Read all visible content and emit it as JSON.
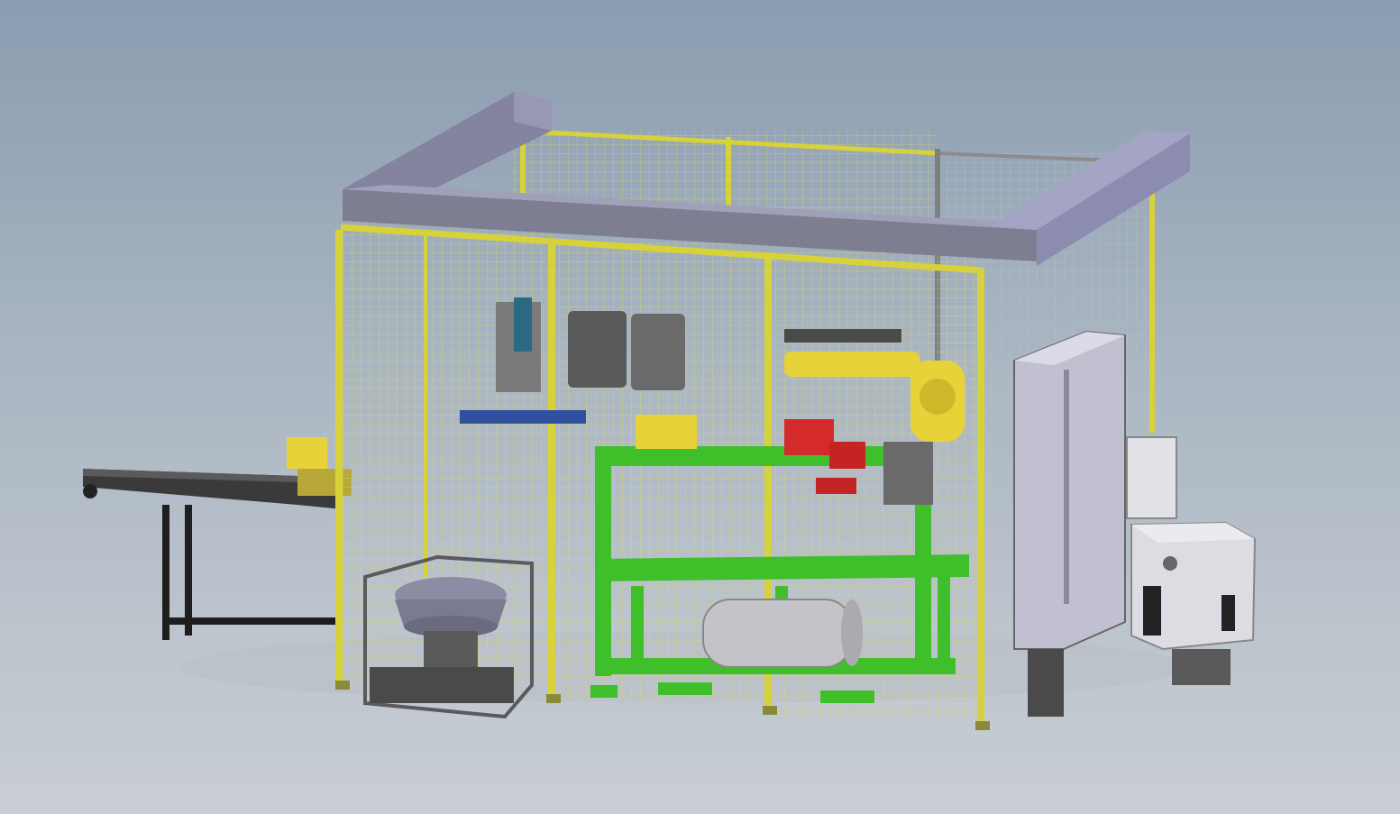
{
  "viewport": {
    "background_top": "#8a9cb0",
    "background_bottom": "#c9ced4"
  },
  "colors": {
    "fence_frame": "#d8d23a",
    "fence_mesh": "#e0dc5a",
    "overhead_beam": "#8f8fa8",
    "robot": "#e8d23a",
    "base_frame": "#3fbf2a",
    "feeder_trays": "#d42a2a",
    "control_cabinet": "#b8b8c8",
    "controller": "#d8d8de",
    "conveyor": "#2a2a2a",
    "tank": "#c8c8c8"
  }
}
